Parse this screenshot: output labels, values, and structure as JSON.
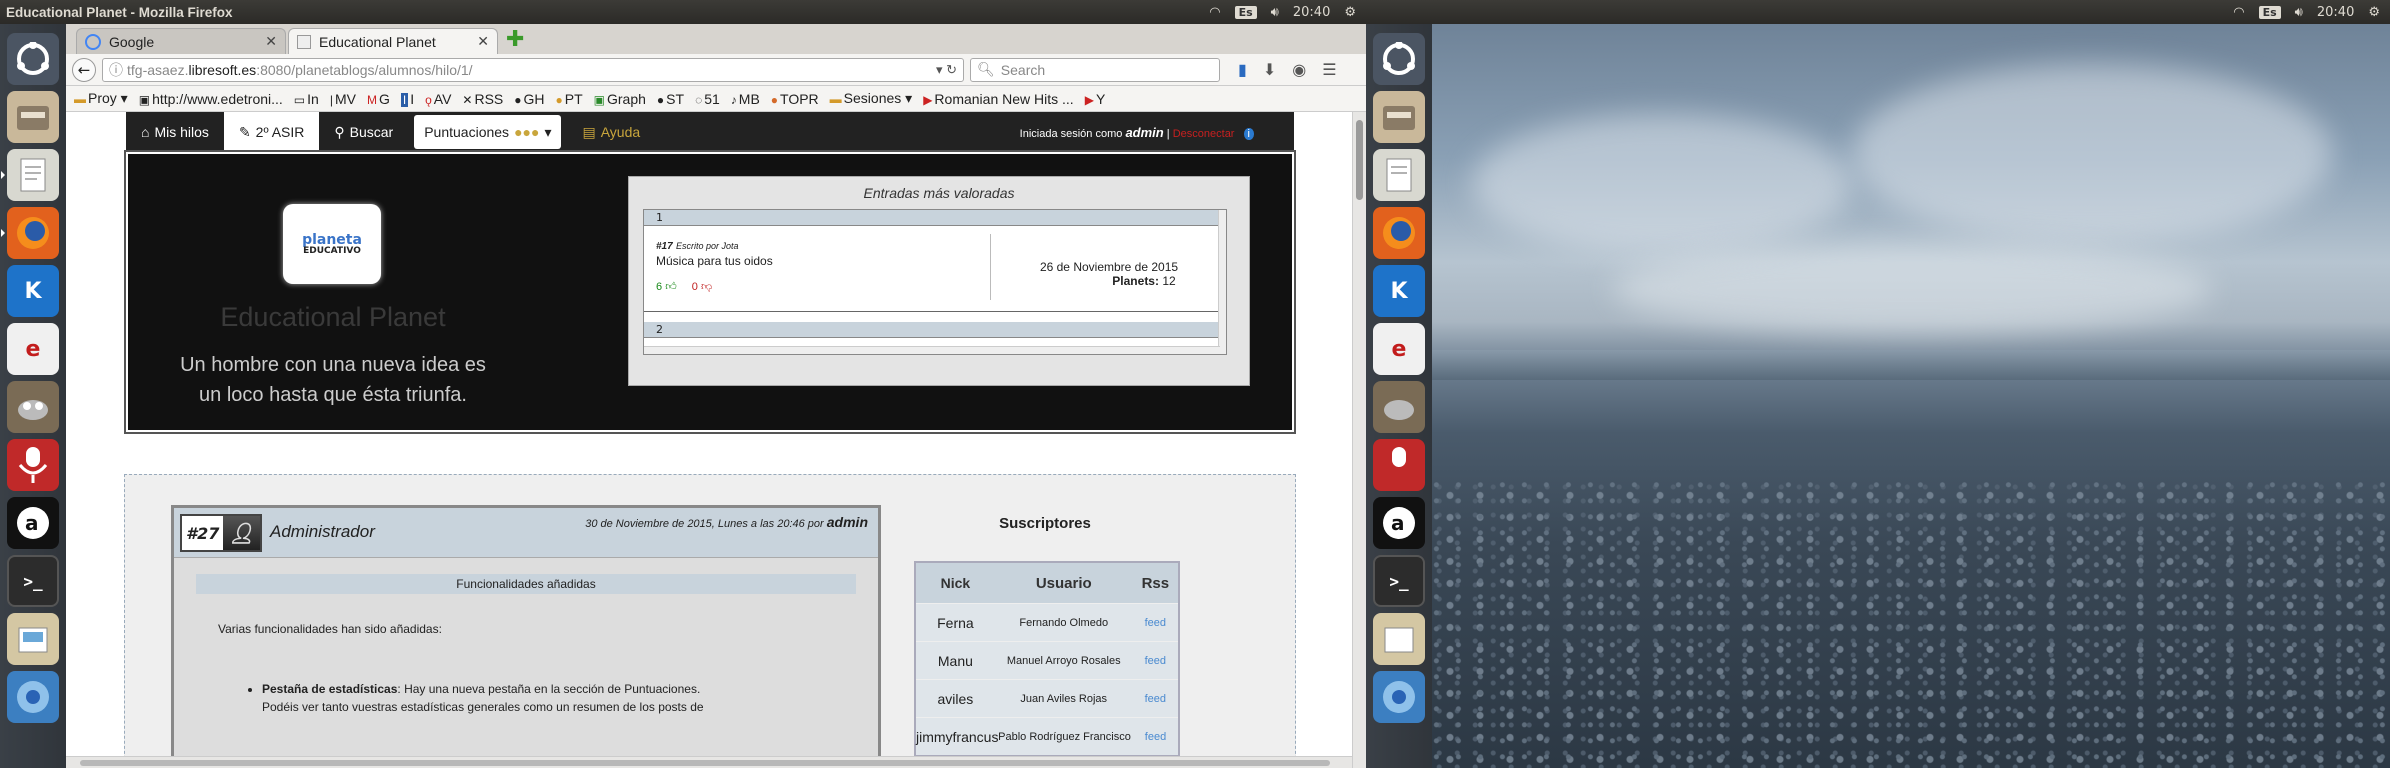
{
  "window_title": "Educational Planet - Mozilla Firefox",
  "panel": {
    "lang": "Es",
    "time": "20:40"
  },
  "launcher_icons": [
    "ubuntu-icon",
    "files-icon",
    "text-editor-icon",
    "firefox-icon",
    "kde-connect-icon",
    "emacs-icon",
    "gimp-icon",
    "podcast-icon",
    "amazon-icon",
    "terminal-icon",
    "writer-icon",
    "chromium-icon"
  ],
  "tabs": [
    {
      "label": "Google"
    },
    {
      "label": "Educational Planet"
    }
  ],
  "url": {
    "host": "tfg-asaez.",
    "domain": "libresoft.es",
    "rest": ":8080/planetablogs/alumnos/hilo/1/"
  },
  "search_placeholder": "Search",
  "bookmarks": [
    "Proy",
    "http://www.edetroni...",
    "In",
    "MV",
    "G",
    "I",
    "AV",
    "RSS",
    "GH",
    "PT",
    "Graph",
    "ST",
    "51",
    "MB",
    "TOPR",
    "Sesiones",
    "Romanian New Hits ...",
    "Y"
  ],
  "site_nav": {
    "mis_hilos": "Mis hilos",
    "asir": "2º ASIR",
    "buscar": "Buscar",
    "puntuaciones": "Puntuaciones",
    "ayuda": "Ayuda",
    "login_prefix": "Iniciada sesión como",
    "user": "admin",
    "sep": "|",
    "logout": "Desconectar",
    "info": "i"
  },
  "hero": {
    "logo_line1": "planeta",
    "logo_line2": "EDUCATIVO",
    "name": "Educational Planet",
    "motto": "Un hombre con una nueva idea es un loco hasta que ésta triunfa.",
    "panel_title": "Entradas más valoradas",
    "rank1": "1",
    "rank2": "2",
    "entry_num": "#17",
    "entry_by": "Escrito por Jota",
    "entry_title": "Música para tus oidos",
    "up": "6",
    "down": "0",
    "entry_date": "26 de Noviembre de 2015",
    "planets_label": "Planets:",
    "planets": "12"
  },
  "post": {
    "id": "#27",
    "author": "Administrador",
    "date": "30 de Noviembre de 2015, Lunes a las 20:46 por",
    "date_user": "admin",
    "title": "Funcionalidades añadidas",
    "intro": "Varias funcionalidades han sido añadidas:",
    "bullet_strong": "Pestaña de estadísticas",
    "bullet_text": ": Hay una nueva pestaña en la sección de Puntuaciones.",
    "bullet_text2": "Podéis ver tanto vuestras estadísticas generales como un resumen de los posts de"
  },
  "subs": {
    "title": "Suscriptores",
    "headers": {
      "nick": "Nick",
      "usuario": "Usuario",
      "rss": "Rss"
    },
    "rows": [
      {
        "nick": "Ferna",
        "usuario": "Fernando Olmedo",
        "rss": "feed"
      },
      {
        "nick": "Manu",
        "usuario": "Manuel Arroyo Rosales",
        "rss": "feed"
      },
      {
        "nick": "aviles",
        "usuario": "Juan Aviles Rojas",
        "rss": "feed"
      },
      {
        "nick": "jimmyfrancus",
        "usuario": "Pablo Rodríguez Francisco",
        "rss": "feed"
      }
    ]
  }
}
